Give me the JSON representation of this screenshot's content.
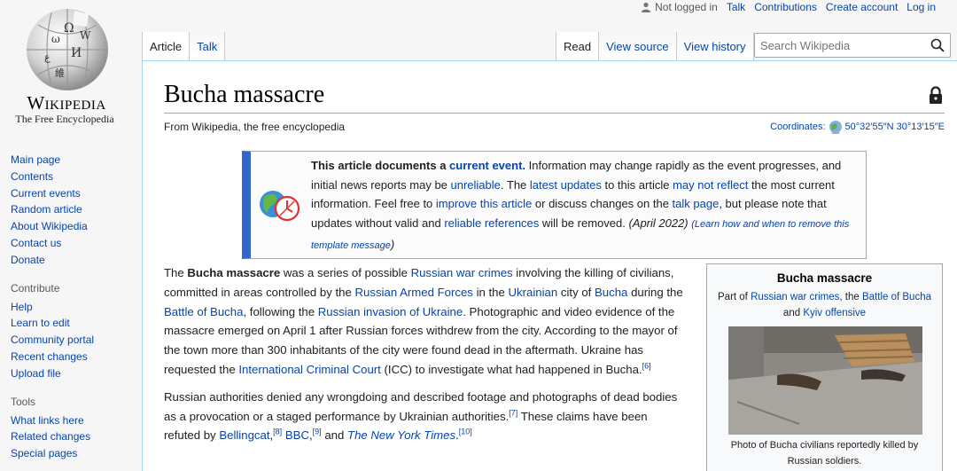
{
  "personal": {
    "not_logged_in": "Not logged in",
    "talk": "Talk",
    "contributions": "Contributions",
    "create_account": "Create account",
    "log_in": "Log in"
  },
  "logo": {
    "wordmark": "Wikipedia",
    "tagline": "The Free Encyclopedia"
  },
  "sidebar": {
    "nav": [
      "Main page",
      "Contents",
      "Current events",
      "Random article",
      "About Wikipedia",
      "Contact us",
      "Donate"
    ],
    "contribute_heading": "Contribute",
    "contribute": [
      "Help",
      "Learn to edit",
      "Community portal",
      "Recent changes",
      "Upload file"
    ],
    "tools_heading": "Tools",
    "tools": [
      "What links here",
      "Related changes",
      "Special pages"
    ]
  },
  "tabs": {
    "article": "Article",
    "talk": "Talk",
    "read": "Read",
    "view_source": "View source",
    "view_history": "View history"
  },
  "search": {
    "placeholder": "Search Wikipedia"
  },
  "page": {
    "title": "Bucha massacre",
    "tagline": "From Wikipedia, the free encyclopedia",
    "coords_label": "Coordinates:",
    "coords_value": "50°32′55″N 30°13′15″E"
  },
  "ambox": {
    "t1": "This article documents a ",
    "l_current_event": "current event.",
    "t2": " Information may change rapidly as the event progresses, and initial news reports may be ",
    "l_unreliable": "unreliable",
    "t3": ". The ",
    "l_latest_updates": "latest updates",
    "t4": " to this article ",
    "l_may_not_reflect": "may not reflect",
    "t5": " the most current information. Feel free to ",
    "l_improve": "improve this article",
    "t6": " or discuss changes on the ",
    "l_talk_page": "talk page",
    "t7": ", but please note that updates without valid and ",
    "l_reliable_refs": "reliable references",
    "t8": " will be removed. ",
    "date": "(April 2022)",
    "l_learn": "(Learn how and when to remove this template message",
    "close_paren": ")"
  },
  "body": {
    "p1_a": "The ",
    "p1_bold": "Bucha massacre",
    "p1_b": " was a series of possible ",
    "p1_l1": "Russian war crimes",
    "p1_c": " involving the killing of civilians, committed in areas controlled by the ",
    "p1_l2": "Russian Armed Forces",
    "p1_d": " in the ",
    "p1_l3": "Ukrainian",
    "p1_e": " city of ",
    "p1_l4": "Bucha",
    "p1_f": " during the ",
    "p1_l5": "Battle of Bucha",
    "p1_g": ", following the ",
    "p1_l6": "Russian invasion of Ukraine",
    "p1_h": ". Photographic and video evidence of the massacre emerged on April 1 after Russian forces withdrew from the city. According to the mayor of the town more than 300 inhabitants of the city were found dead in the aftermath. Ukraine has requested the ",
    "p1_l7": "International Criminal Court",
    "p1_i": " (ICC) to investigate what had happened in Bucha.",
    "p1_ref": "[6]",
    "p2_a": "Russian authorities denied any wrongdoing and described footage and photographs of dead bodies as a provocation or a staged performance by Ukrainian authorities.",
    "p2_ref1": "[7]",
    "p2_b": " These claims have been refuted by ",
    "p2_l1": "Bellingcat",
    "p2_ref2": "[8]",
    "p2_c": " ",
    "p2_l2": "BBC",
    "p2_ref3": "[9]",
    "p2_d": " and ",
    "p2_l3": "The New York Times",
    "p2_e": ".",
    "p2_ref4": "[10]"
  },
  "infobox": {
    "title": "Bucha massacre",
    "part_of": "Part of ",
    "l1": "Russian war crimes",
    "sep": ", the ",
    "l2": "Battle of Bucha",
    "and": " and ",
    "l3": "Kyiv offensive",
    "caption": "Photo of Bucha civilians reportedly killed by Russian soldiers."
  }
}
